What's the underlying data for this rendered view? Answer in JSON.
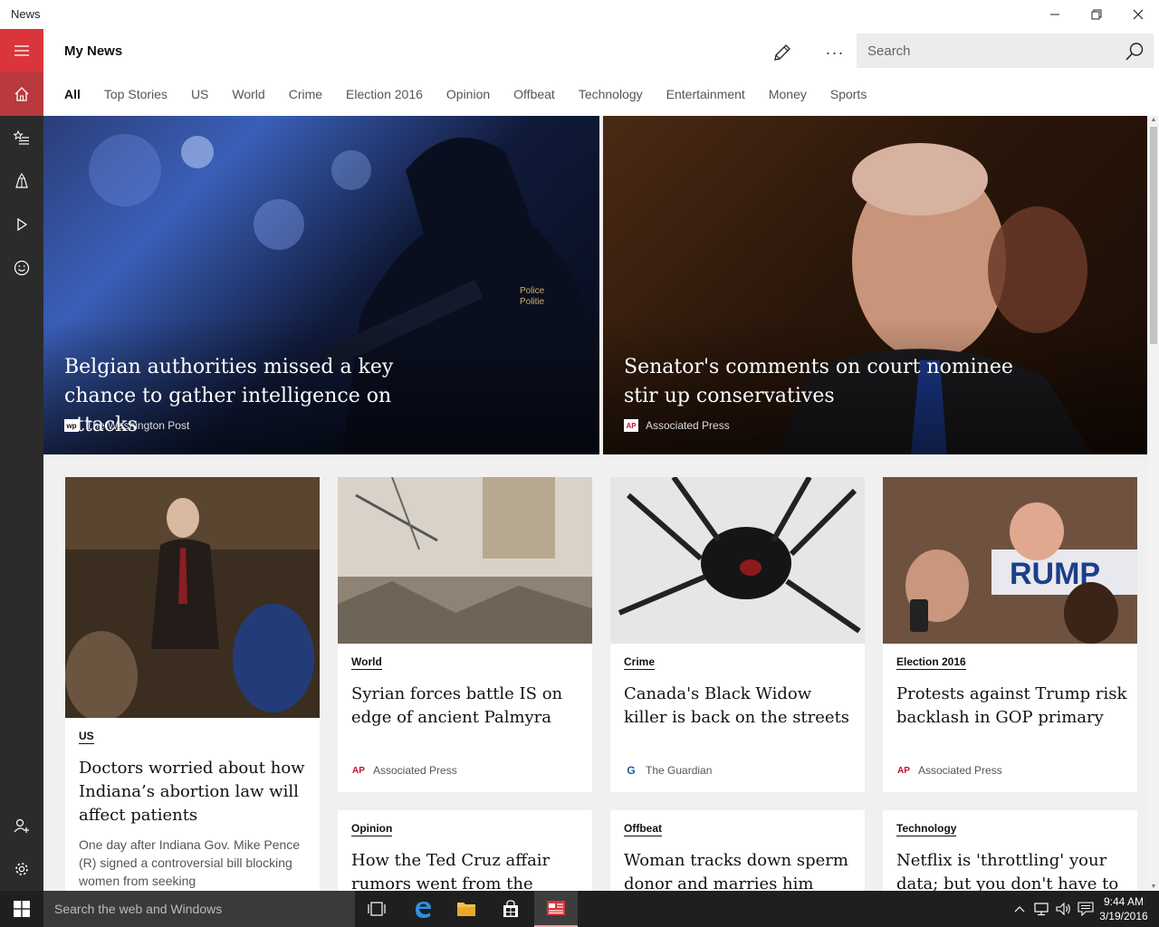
{
  "window": {
    "app_title": "News"
  },
  "header": {
    "title": "My News",
    "search_placeholder": "Search",
    "more_label": "···"
  },
  "tabs": [
    {
      "label": "All",
      "active": true
    },
    {
      "label": "Top Stories"
    },
    {
      "label": "US"
    },
    {
      "label": "World"
    },
    {
      "label": "Crime"
    },
    {
      "label": "Election 2016"
    },
    {
      "label": "Opinion"
    },
    {
      "label": "Offbeat"
    },
    {
      "label": "Technology"
    },
    {
      "label": "Entertainment"
    },
    {
      "label": "Money"
    },
    {
      "label": "Sports"
    }
  ],
  "rail": {
    "items": [
      {
        "icon": "hamburger-icon"
      },
      {
        "icon": "home-icon"
      },
      {
        "icon": "star-list-icon"
      },
      {
        "icon": "local-icon"
      },
      {
        "icon": "video-play-icon"
      },
      {
        "icon": "smiley-icon"
      },
      {
        "icon": "add-user-icon"
      },
      {
        "icon": "gear-icon"
      }
    ]
  },
  "heroes": [
    {
      "headline": "Belgian authorities missed a key chance to gather intelligence on attacks",
      "source": "The Washington Post",
      "source_logo": "wp"
    },
    {
      "headline": "Senator's comments on court nominee stir up conservatives",
      "source": "Associated Press",
      "source_logo": "AP"
    }
  ],
  "cards": [
    {
      "category": "US",
      "title": "Doctors worried about how Indiana’s abortion law will affect patients",
      "summary": "One day after Indiana Gov. Mike Pence (R) signed a controversial bill blocking women from seeking"
    },
    {
      "category": "World",
      "title": "Syrian forces battle IS on edge of ancient Palmyra",
      "source": "Associated Press",
      "source_logo": "AP"
    },
    {
      "category": "Crime",
      "title": "Canada's Black Widow killer is back on the streets",
      "source": "The Guardian",
      "source_logo": "G"
    },
    {
      "category": "Election 2016",
      "title": "Protests against Trump risk backlash in GOP primary",
      "source": "Associated Press",
      "source_logo": "AP"
    },
    {
      "category": "Opinion",
      "title": "How the Ted Cruz affair rumors went from the"
    },
    {
      "category": "Offbeat",
      "title": "Woman tracks down sperm donor and marries him"
    },
    {
      "category": "Technology",
      "title": "Netflix is 'throttling' your data; but you don't have to"
    }
  ],
  "taskbar": {
    "search_placeholder": "Search the web and Windows",
    "time": "9:44 AM",
    "date": "3/19/2016"
  },
  "colors": {
    "accent": "#d9353b",
    "rail_bg": "#2b2b2b",
    "content_bg": "#f0f0f0",
    "taskbar_bg": "#1f1f1f"
  }
}
